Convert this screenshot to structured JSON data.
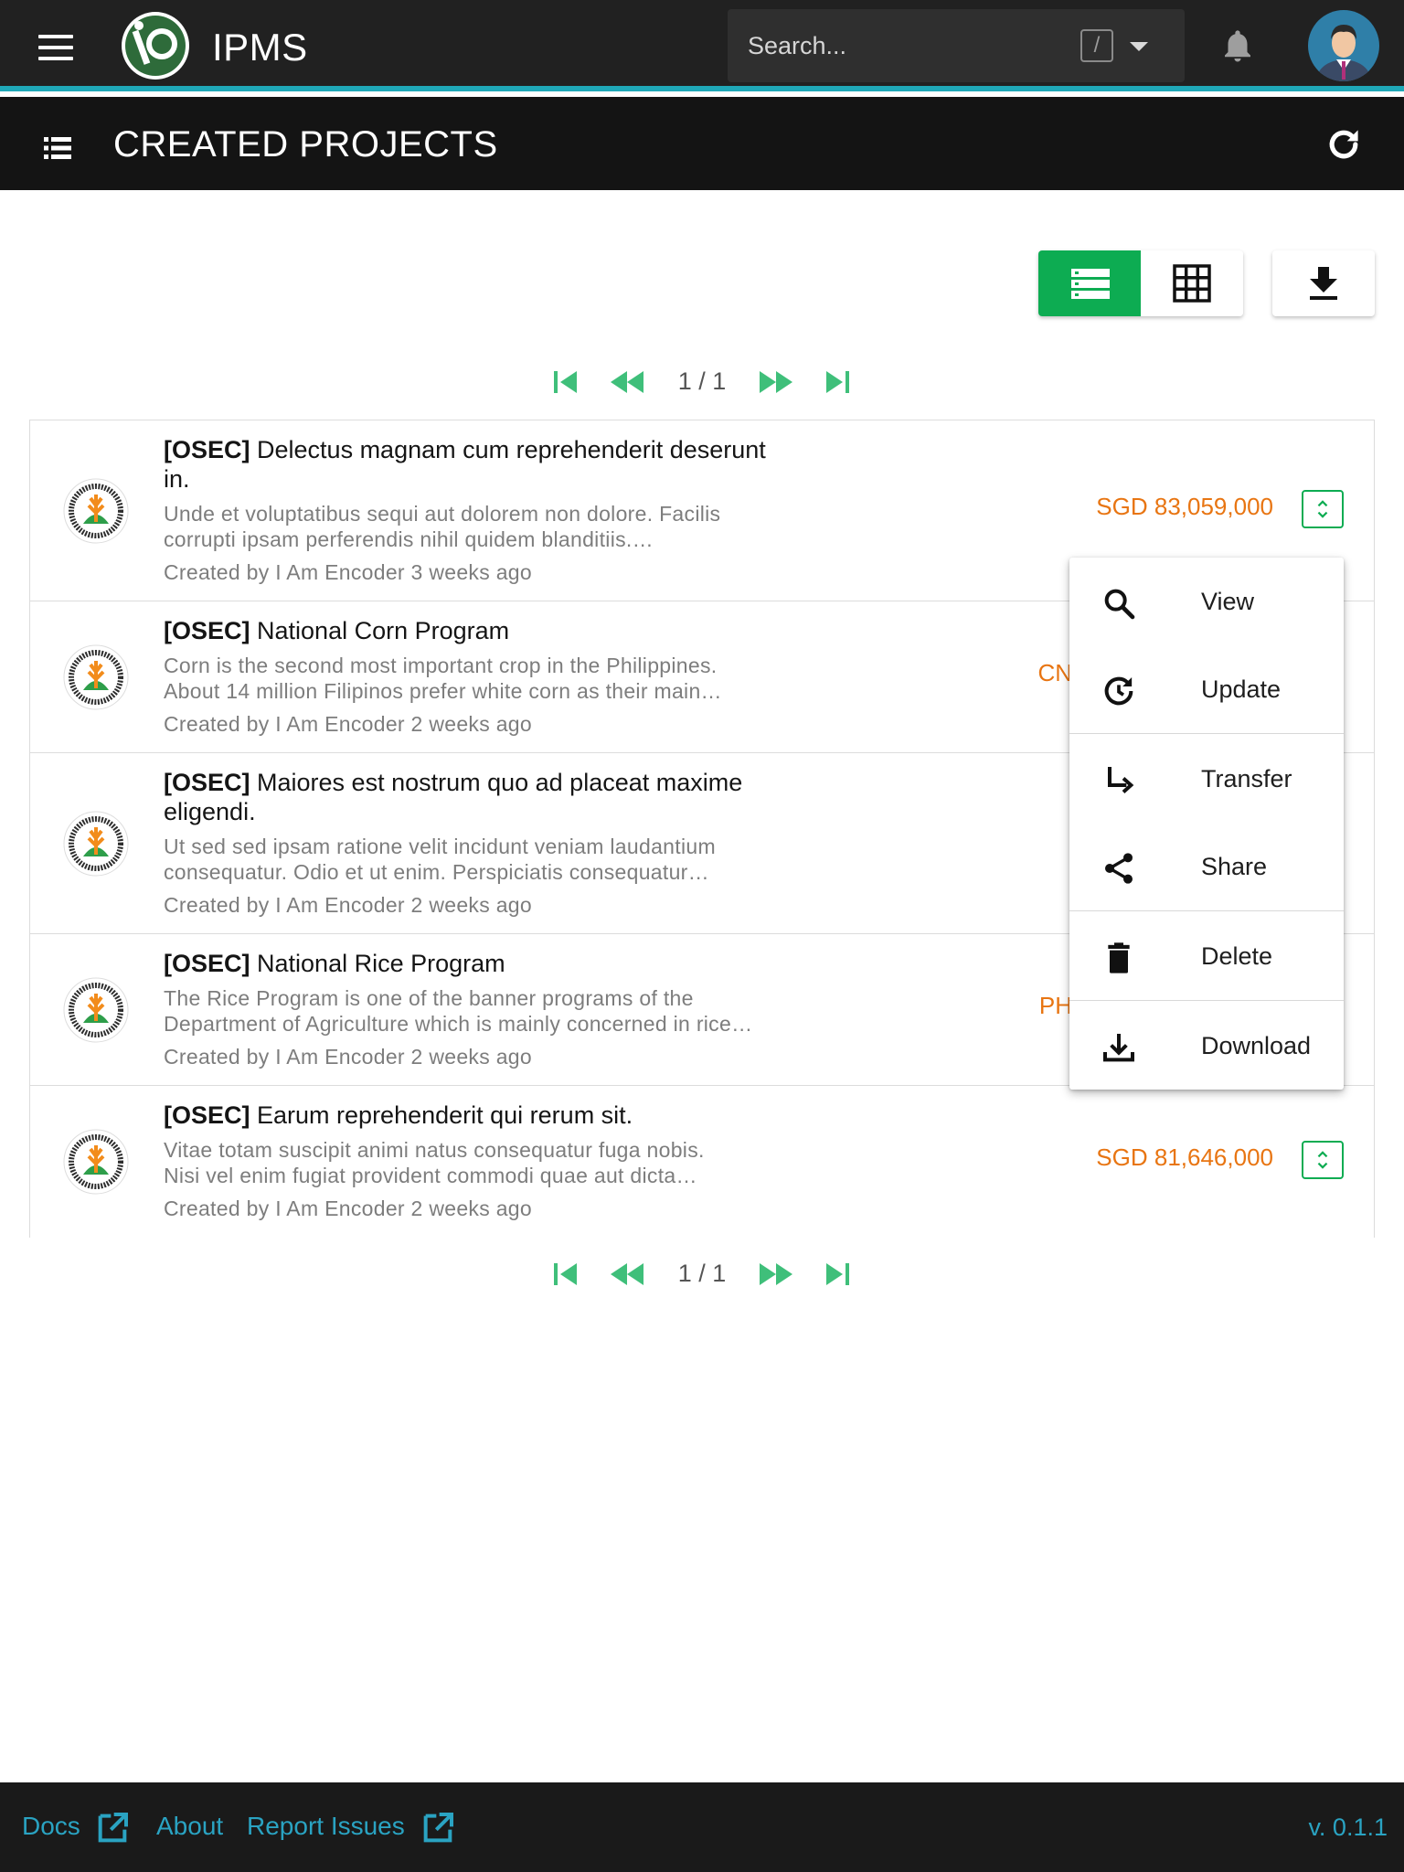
{
  "app": {
    "title": "IPMS"
  },
  "search": {
    "placeholder": "Search...",
    "shortcut": "/"
  },
  "section": {
    "title": "CREATED PROJECTS"
  },
  "pagination": {
    "text": "1 / 1"
  },
  "projects": [
    {
      "agency": "[OSEC]",
      "title": "Delectus magnam cum reprehenderit deserunt in.",
      "title_line2": "in.",
      "desc1": "Unde et voluptatibus sequi aut dolorem non dolore. Facilis",
      "desc2": "corrupti ipsam perferendis nihil quidem blanditiis.…",
      "meta": "Created by I Am Encoder 3 weeks ago",
      "amount": "SGD 83,059,000"
    },
    {
      "agency": "[OSEC]",
      "title": "National Corn Program",
      "desc1": "Corn is the second most important crop in the Philippines.",
      "desc2": "About 14 million Filipinos prefer white corn as their main…",
      "meta": "Created by I Am Encoder 2 weeks ago",
      "amount": "CN"
    },
    {
      "agency": "[OSEC]",
      "title": "Maiores est nostrum quo ad placeat maxime",
      "title_line2": "eligendi.",
      "desc1": "Ut sed sed ipsam ratione velit incidunt veniam laudantium",
      "desc2": "consequatur. Odio et ut enim. Perspiciatis consequatur…",
      "meta": "Created by I Am Encoder 2 weeks ago",
      "amount": ""
    },
    {
      "agency": "[OSEC]",
      "title": "National Rice Program",
      "desc1": "The Rice Program is one of the banner programs of the",
      "desc2": "Department of Agriculture which is mainly concerned in rice…",
      "meta": "Created by I Am Encoder 2 weeks ago",
      "amount": "PH"
    },
    {
      "agency": "[OSEC]",
      "title": "Earum reprehenderit qui rerum sit.",
      "desc1": "Vitae totam suscipit animi natus consequatur fuga nobis.",
      "desc2": "Nisi vel enim fugiat provident commodi quae aut dicta…",
      "meta": "Created by I Am Encoder 2 weeks ago",
      "amount": "SGD 81,646,000"
    }
  ],
  "menu": {
    "items": [
      {
        "label": "View",
        "icon": "search-icon"
      },
      {
        "label": "Update",
        "icon": "update-icon"
      },
      {
        "label": "Transfer",
        "icon": "transfer-icon"
      },
      {
        "label": "Share",
        "icon": "share-icon"
      },
      {
        "label": "Delete",
        "icon": "delete-icon"
      },
      {
        "label": "Download",
        "icon": "download-icon"
      }
    ]
  },
  "footer": {
    "docs": "Docs",
    "about": "About",
    "report": "Report Issues",
    "version": "v. 0.1.1"
  },
  "colors": {
    "accent_green": "#0dac52",
    "teal": "#1fa8b8",
    "amount_orange": "#e87512",
    "link_blue": "#2aa3c2"
  }
}
